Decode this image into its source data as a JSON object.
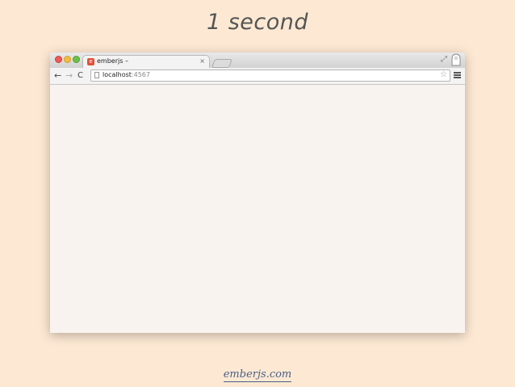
{
  "slide": {
    "title": "1 second",
    "footer_link": "emberjs.com"
  },
  "browser": {
    "tab": {
      "favicon_letter": "e",
      "title": "emberjs –",
      "close": "×"
    },
    "toolbar": {
      "back_glyph": "←",
      "forward_glyph": "→",
      "reload_glyph": "C",
      "url_host": "localhost",
      "url_port": ":4567",
      "star_glyph": "☆",
      "resize_glyph": "⤢"
    }
  },
  "colors": {
    "slide_background": "#fde9d3",
    "viewport_background": "#f9f3ef",
    "link": "#4a5e86",
    "ember_brand": "#e04e39"
  },
  "icons": [
    "close-window-icon",
    "minimize-window-icon",
    "zoom-window-icon",
    "ember-favicon-icon",
    "back-arrow-icon",
    "forward-arrow-icon",
    "reload-icon",
    "page-icon",
    "star-icon",
    "menu-icon",
    "fullscreen-icon",
    "profile-icon"
  ]
}
